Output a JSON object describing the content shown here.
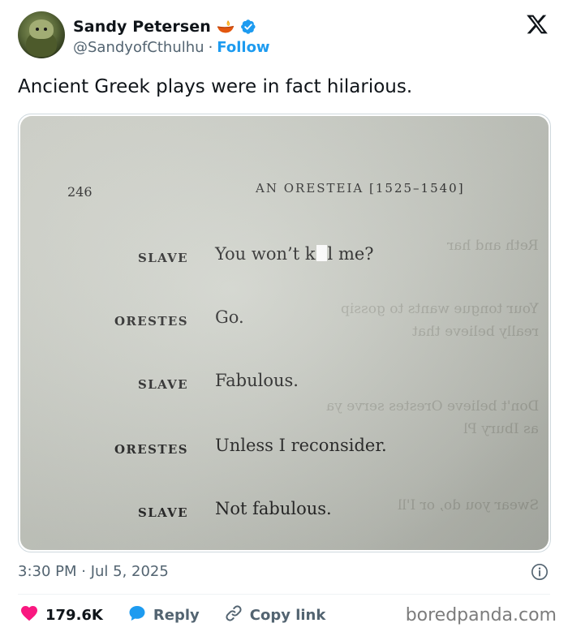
{
  "author": {
    "display_name": "Sandy Petersen",
    "handle": "@SandyofCthulhu",
    "separator": "·",
    "follow_label": "Follow",
    "badges": [
      "diya-lamp-icon",
      "verified-badge-icon"
    ],
    "verified_color": "#1d9bf0"
  },
  "platform_logo": "x-logo-icon",
  "tweet": {
    "text": "Ancient Greek plays were in fact hilarious."
  },
  "photo": {
    "page_number": "246",
    "running_head": "AN ORESTEIA [1525–1540]",
    "dialogue": [
      {
        "speaker": "SLAVE",
        "line_before": "You won’t k",
        "censored": true,
        "line_after": "l me?"
      },
      {
        "speaker": "ORESTES",
        "line": "Go."
      },
      {
        "speaker": "SLAVE",
        "line": "Fabulous."
      },
      {
        "speaker": "ORESTES",
        "line": "Unless I reconsider."
      },
      {
        "speaker": "SLAVE",
        "line": "Not fabulous."
      }
    ]
  },
  "timestamp": "3:30 PM · Jul 5, 2025",
  "actions": {
    "like_count": "179.6K",
    "reply_label": "Reply",
    "copy_link_label": "Copy link",
    "like_color": "#f91880",
    "reply_color": "#1d9bf0"
  },
  "watermark": "boredpanda.com"
}
